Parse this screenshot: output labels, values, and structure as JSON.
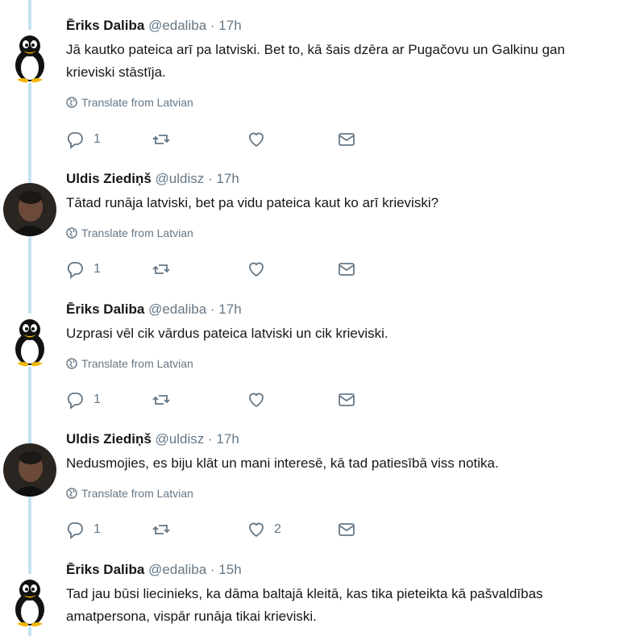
{
  "tweets": [
    {
      "author": "Ēriks Daliba",
      "handle": "@edaliba",
      "sep": "·",
      "time": "17h",
      "avatar": "penguin-icon",
      "lines": [
        "Jā kautko pateica arī pa latviski. Bet to, kā šais dzēra ar Pugačovu un Galkinu gan",
        "krieviski stāstīja."
      ],
      "translate": "Translate from Latvian",
      "replies": "1",
      "retweets": "",
      "likes": ""
    },
    {
      "author": "Uldis Ziediņš",
      "handle": "@uldisz",
      "sep": "·",
      "time": "17h",
      "avatar": "person-photo",
      "lines": [
        "Tātad runāja latviski, bet pa vidu pateica kaut ko arī krieviski?"
      ],
      "translate": "Translate from Latvian",
      "replies": "1",
      "retweets": "",
      "likes": ""
    },
    {
      "author": "Ēriks Daliba",
      "handle": "@edaliba",
      "sep": "·",
      "time": "17h",
      "avatar": "penguin-icon",
      "lines": [
        "Uzprasi vēl cik vārdus pateica latviski un cik krieviski."
      ],
      "translate": "Translate from Latvian",
      "replies": "1",
      "retweets": "",
      "likes": ""
    },
    {
      "author": "Uldis Ziediņš",
      "handle": "@uldisz",
      "sep": "·",
      "time": "17h",
      "avatar": "person-photo",
      "lines": [
        "Nedusmojies, es biju klāt un mani interesē, kā tad patiesībā viss notika."
      ],
      "translate": "Translate from Latvian",
      "replies": "1",
      "retweets": "",
      "likes": "2"
    },
    {
      "author": "Ēriks Daliba",
      "handle": "@edaliba",
      "sep": "·",
      "time": "15h",
      "avatar": "penguin-icon",
      "lines": [
        "Tad jau būsi liecinieks, ka dāma baltajā kleitā, kas tika pieteikta kā pašvaldības",
        "amatpersona, vispār runāja tikai krieviski."
      ]
    }
  ]
}
